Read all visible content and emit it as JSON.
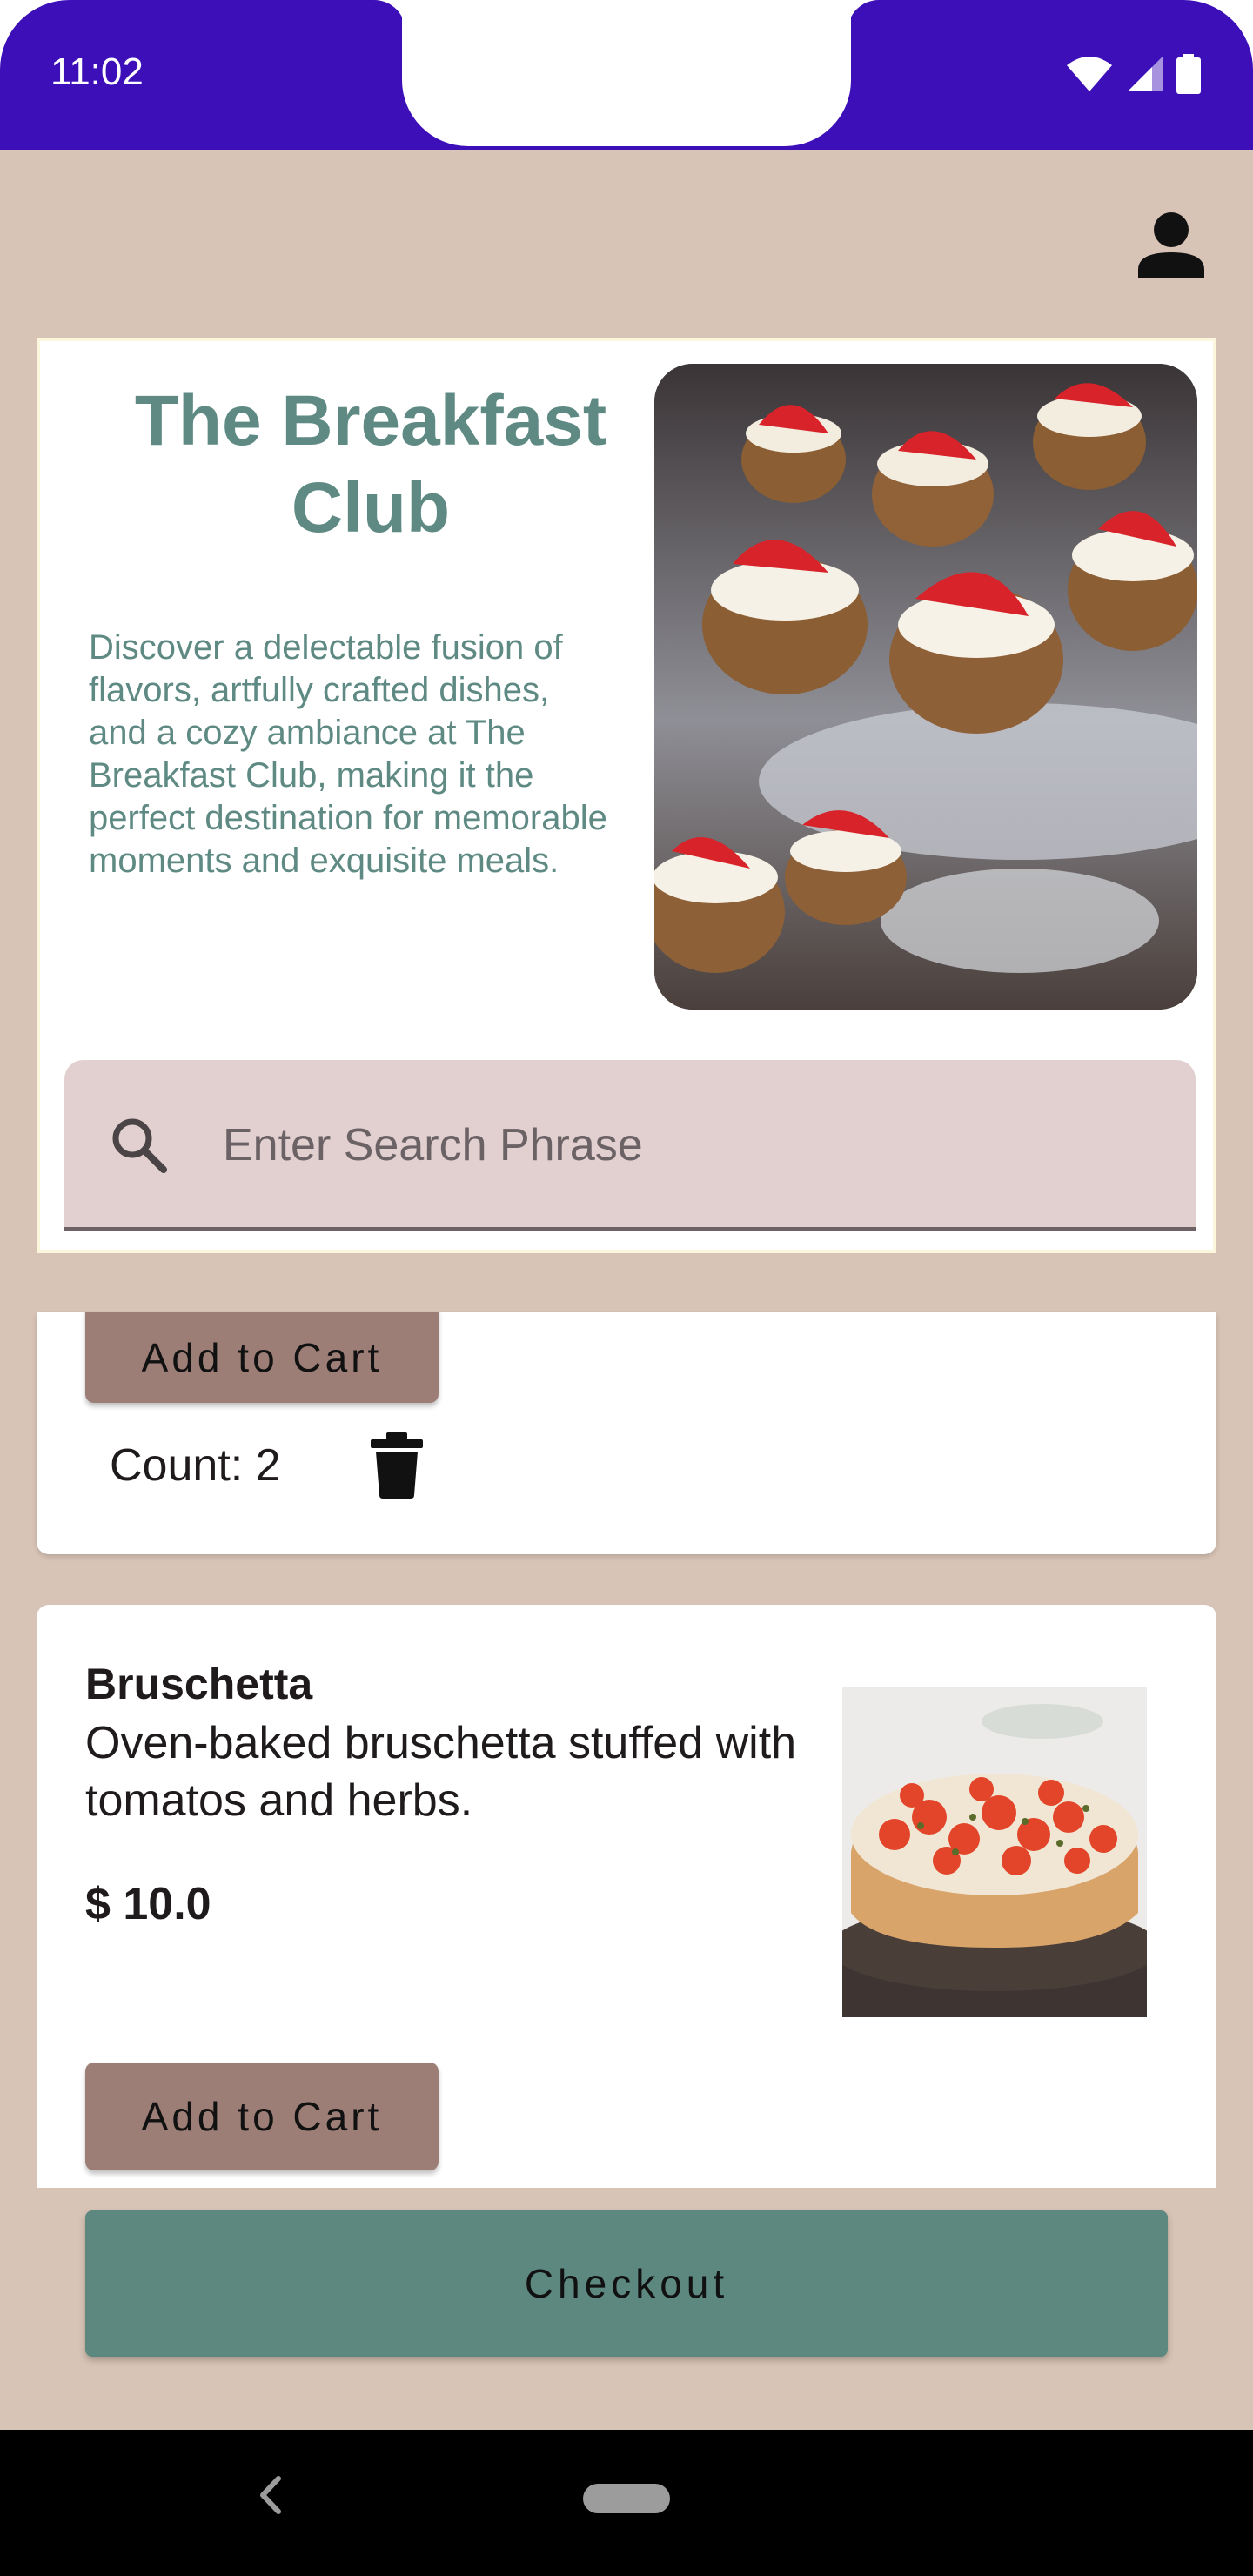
{
  "status_bar": {
    "time": "11:02"
  },
  "header": {
    "profile_icon": "person-icon"
  },
  "hero": {
    "title": "The Breakfast Club",
    "description": "Discover a delectable fusion of flavors, artfully crafted dishes, and a cozy ambiance at The Breakfast Club, making it the perfect destination for memorable moments and exquisite meals.",
    "image": "strawberry-cream-tarts-photo"
  },
  "search": {
    "placeholder": "Enter Search Phrase",
    "value": "",
    "icon": "search-icon"
  },
  "menu_items": [
    {
      "add_label": "Add to Cart",
      "count_label": "Count: 2",
      "delete_icon": "trash-icon"
    },
    {
      "name": "Bruschetta",
      "description": "Oven-baked bruschetta stuffed with tomatos and herbs.",
      "price": "$ 10.0",
      "image": "bruschetta-photo",
      "add_label": "Add to Cart"
    }
  ],
  "checkout": {
    "label": "Checkout"
  },
  "colors": {
    "status_bar": "#3c0fb8",
    "background": "#d8c4b6",
    "accent_teal": "#5e8a83",
    "button_brown": "#9c7e76",
    "search_bg": "#e2cfcf"
  }
}
